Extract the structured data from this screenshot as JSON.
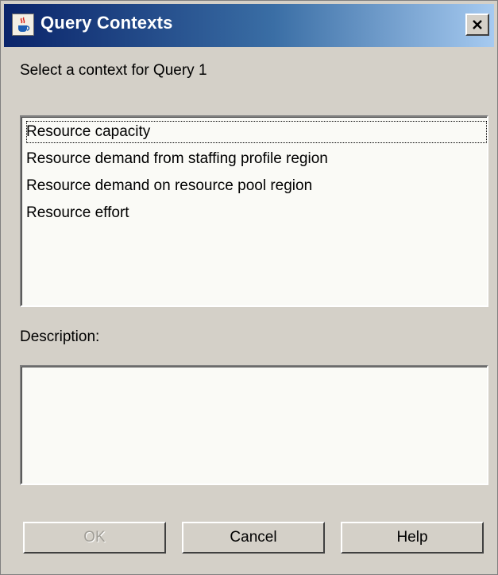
{
  "window": {
    "title": "Query Contexts",
    "title_icon": "java-cup-icon",
    "close_icon": "close-x-icon"
  },
  "prompt": "Select a context for Query 1",
  "contexts": {
    "items": [
      {
        "label": "Resource capacity",
        "focused": true
      },
      {
        "label": "Resource demand from staffing profile region",
        "focused": false
      },
      {
        "label": "Resource demand on resource pool region",
        "focused": false
      },
      {
        "label": "Resource effort",
        "focused": false
      }
    ]
  },
  "description": {
    "label": "Description:",
    "value": ""
  },
  "buttons": {
    "ok": {
      "label": "OK",
      "enabled": false
    },
    "cancel": {
      "label": "Cancel",
      "enabled": true
    },
    "help": {
      "label": "Help",
      "enabled": true
    }
  },
  "colors": {
    "title_gradient_start": "#0a246a",
    "title_gradient_end": "#a6caf0",
    "dialog_background": "#d4d0c8",
    "field_background": "#fafaf6"
  }
}
